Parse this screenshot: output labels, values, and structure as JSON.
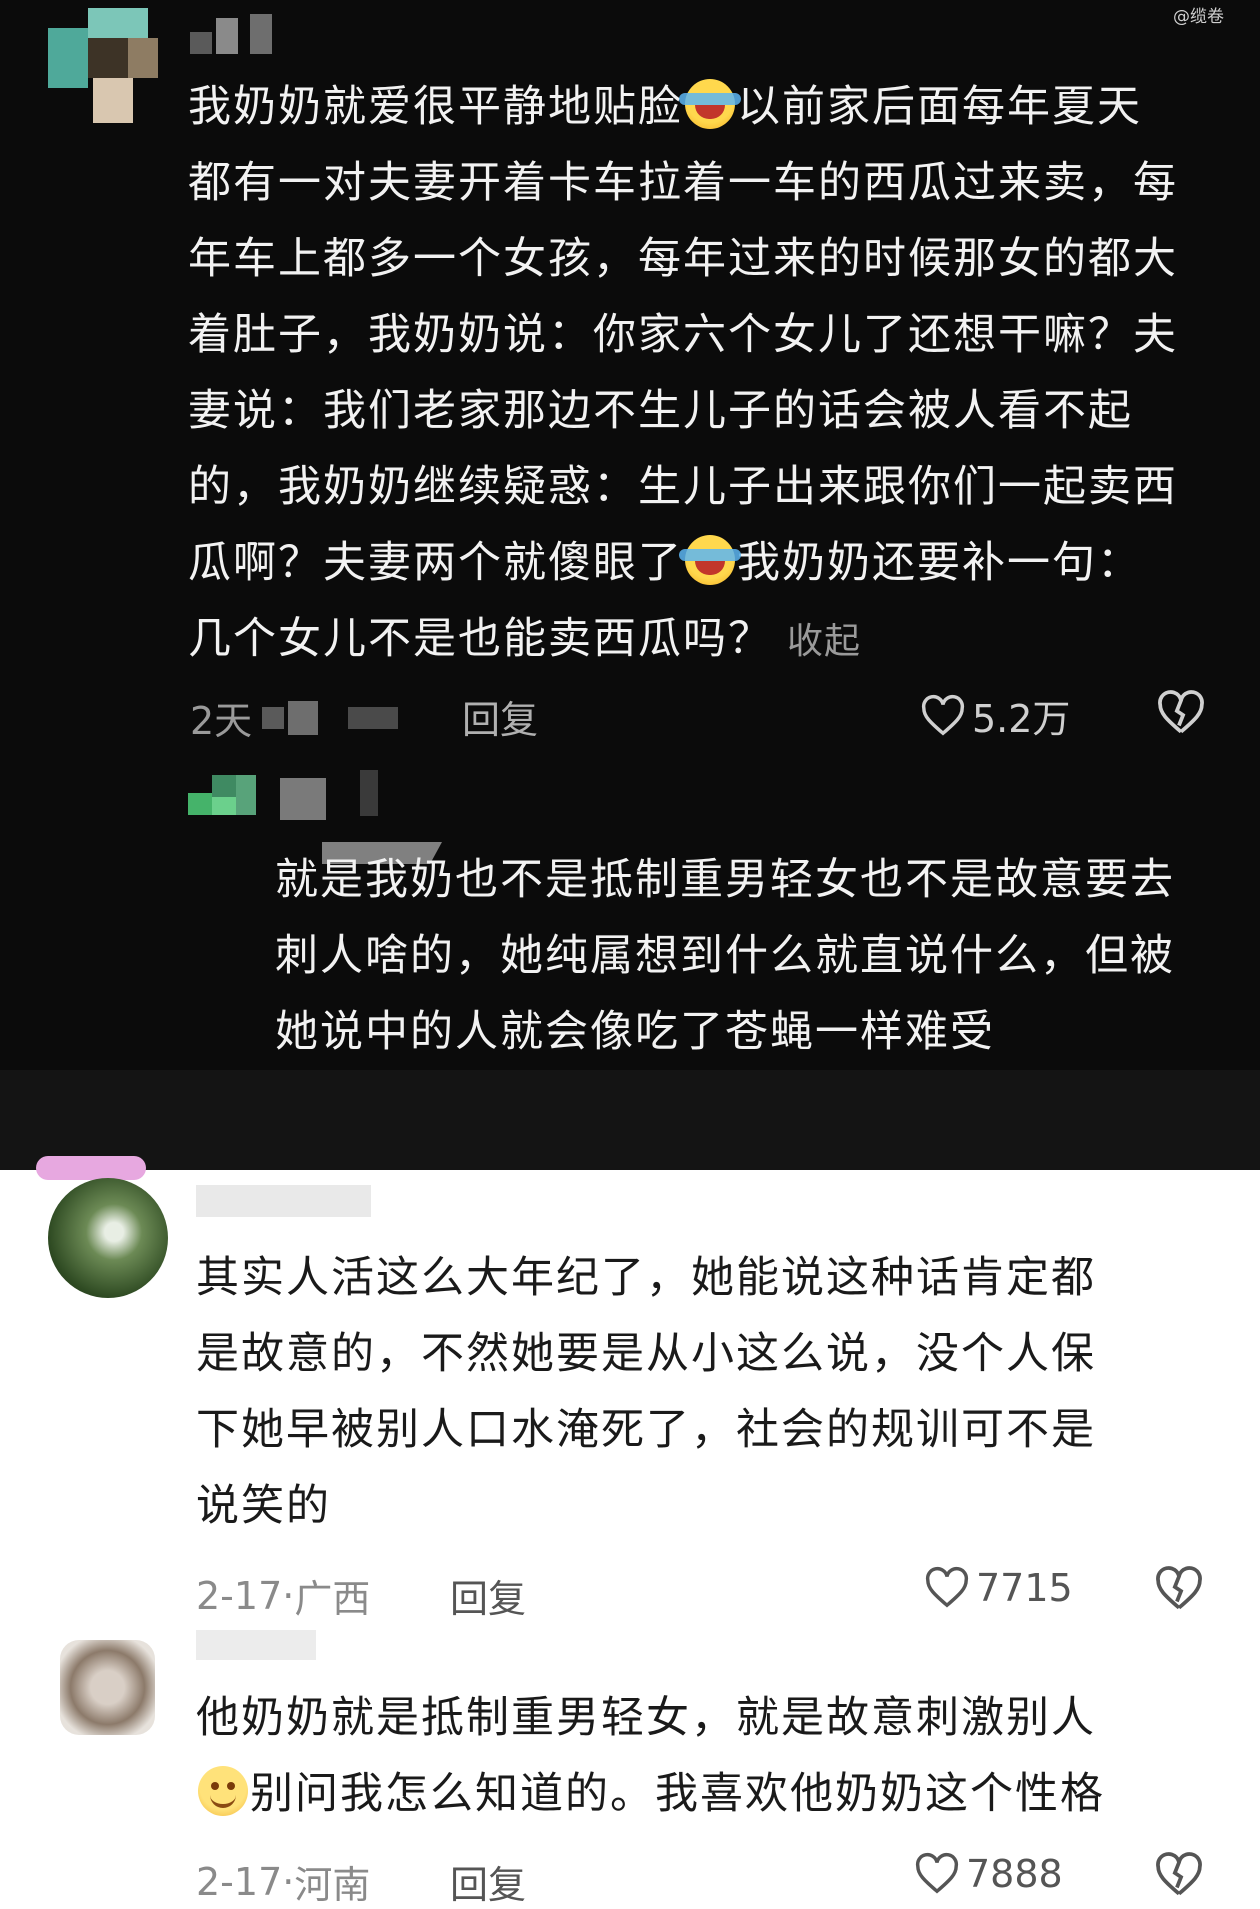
{
  "watermark": "@缆卷",
  "comments": [
    {
      "text_before": "我奶奶就爱很平静地贴脸",
      "text_line1_rest": "以前家后面每年夏天",
      "lines": [
        "都有一对夫妻开着卡车拉着一车的西瓜过来卖，每",
        "年车上都多一个女孩，每年过来的时候那女的都大",
        "着肚子，我奶奶说：你家六个女儿了还想干嘛？夫",
        "妻说：我们老家那边不生儿子的话会被人看不起",
        "的，我奶奶继续疑惑：生儿子出来跟你们一起卖西"
      ],
      "line7_before": "瓜啊？夫妻两个就傻眼了",
      "line7_after": "我奶奶还要补一句：",
      "line8": "几个女儿不是也能卖西瓜吗？",
      "collapse_label": "收起",
      "date_partial": "2天",
      "reply_label": "回复",
      "likes": "5.2万",
      "emoji": "laughing-tears-icon"
    },
    {
      "lines": [
        "就是我奶也不是抵制重男轻女也不是故意要去",
        "刺人啥的，她纯属想到什么就直说什么，但被",
        "她说中的人就会像吃了苍蝇一样难受"
      ]
    },
    {
      "lines": [
        "其实人活这么大年纪了，她能说这种话肯定都",
        "是故意的，不然她要是从小这么说，没个人保",
        "下她早被别人口水淹死了，社会的规训可不是",
        "说笑的"
      ],
      "date": "2-17",
      "location": "广西",
      "reply_label": "回复",
      "likes": "7715"
    },
    {
      "line1": "他奶奶就是抵制重男轻女，就是故意刺激别人",
      "line2": "别问我怎么知道的。我喜欢他奶奶这个性格",
      "emoji": "smile-icon",
      "date": "2-17",
      "location": "河南",
      "reply_label": "回复",
      "likes": "7888"
    }
  ]
}
